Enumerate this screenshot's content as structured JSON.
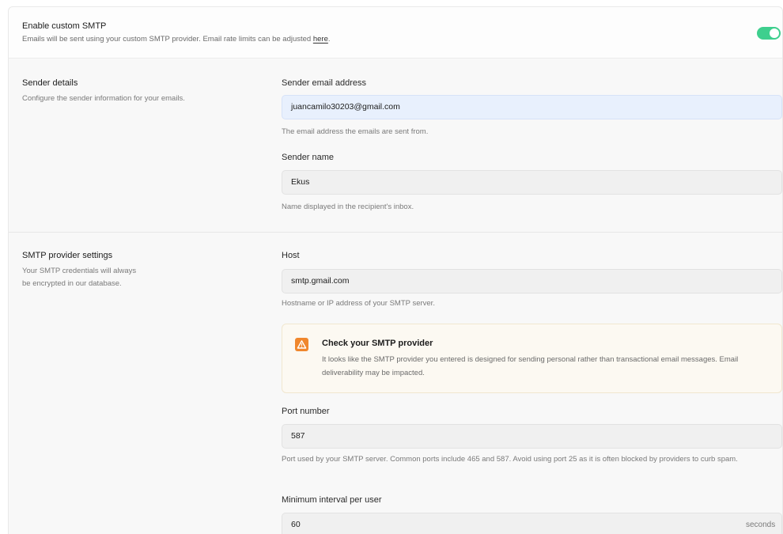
{
  "enable_smtp": {
    "title": "Enable custom SMTP",
    "description": "Emails will be sent using your custom SMTP provider. Email rate limits can be adjusted ",
    "link": "here",
    "description_end": ".",
    "enabled": true
  },
  "sender_details": {
    "title": "Sender details",
    "description": "Configure the sender information for your emails.",
    "email_label": "Sender email address",
    "email_value": "juancamilo30203@gmail.com",
    "email_hint": "The email address the emails are sent from.",
    "name_label": "Sender name",
    "name_value": "Ekus",
    "name_hint": "Name displayed in the recipient's inbox."
  },
  "provider_settings": {
    "title": "SMTP provider settings",
    "description_line1": "Your SMTP credentials will always",
    "description_line2": "be encrypted in our database.",
    "host_label": "Host",
    "host_value": "smtp.gmail.com",
    "host_hint": "Hostname or IP address of your SMTP server.",
    "warning_title": "Check your SMTP provider",
    "warning_body": "It looks like the SMTP provider you entered is designed for sending personal rather than transactional email messages. Email deliverability may be impacted.",
    "port_label": "Port number",
    "port_value": "587",
    "port_hint": "Port used by your SMTP server. Common ports include 465 and 587. Avoid using port 25 as it is often blocked by providers to curb spam.",
    "interval_label": "Minimum interval per user",
    "interval_value": "60",
    "interval_suffix": "seconds"
  },
  "colors": {
    "toggle_on": "#3ecf8e",
    "warning_icon": "#f0872d",
    "focused_input": "#e8f0fd"
  },
  "icons": {
    "warning": "warning-triangle-icon"
  }
}
